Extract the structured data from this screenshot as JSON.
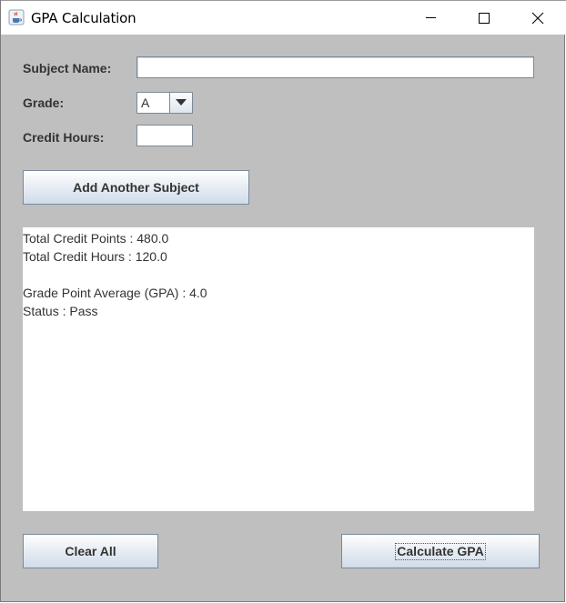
{
  "window": {
    "title": "GPA Calculation"
  },
  "form": {
    "subject_label": "Subject Name:",
    "subject_value": "",
    "grade_label": "Grade:",
    "grade_selected": "A",
    "credit_label": "Credit Hours:",
    "credit_value": ""
  },
  "buttons": {
    "add_label": "Add Another Subject",
    "clear_label": "Clear All",
    "calculate_label": "Calculate GPA"
  },
  "results": {
    "lines": [
      "Total Credit Points : 480.0",
      "Total Credit Hours : 120.0",
      "",
      "Grade Point Average (GPA) : 4.0",
      "Status : Pass"
    ]
  },
  "icons": {
    "app": "java-coffee-icon",
    "minimize": "minimize-icon",
    "maximize": "maximize-icon",
    "close": "close-icon",
    "dropdown": "chevron-down-icon"
  },
  "colors": {
    "panel_bg": "#bfbfbf",
    "button_border": "#7a8a99",
    "text": "#333333"
  }
}
